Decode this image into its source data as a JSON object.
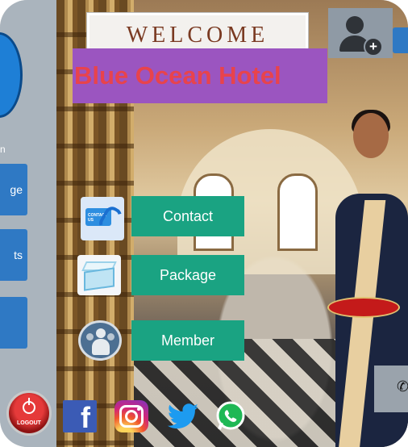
{
  "header": {
    "welcome": "WELCOME",
    "hotel_name": "Blue Ocean Hotel"
  },
  "sidebar": {
    "fragment_text": "n",
    "items": [
      {
        "label": "ge"
      },
      {
        "label": "ts"
      },
      {
        "label": ""
      }
    ],
    "logout_label": "LOGOUT"
  },
  "menu": {
    "items": [
      {
        "label": "Contact",
        "icon": "contact-icon"
      },
      {
        "label": "Package",
        "icon": "package-icon"
      },
      {
        "label": "Member",
        "icon": "members-icon"
      }
    ]
  },
  "social": [
    {
      "name": "facebook-icon",
      "glyph": "f"
    },
    {
      "name": "instagram-icon"
    },
    {
      "name": "twitter-icon"
    },
    {
      "name": "whatsapp-icon"
    }
  ],
  "colors": {
    "menu_button": "#1aa382",
    "hotel_banner_bg": "#9b55c0",
    "hotel_name_text": "#e8434c",
    "sidebar_button": "#2f79c4"
  }
}
